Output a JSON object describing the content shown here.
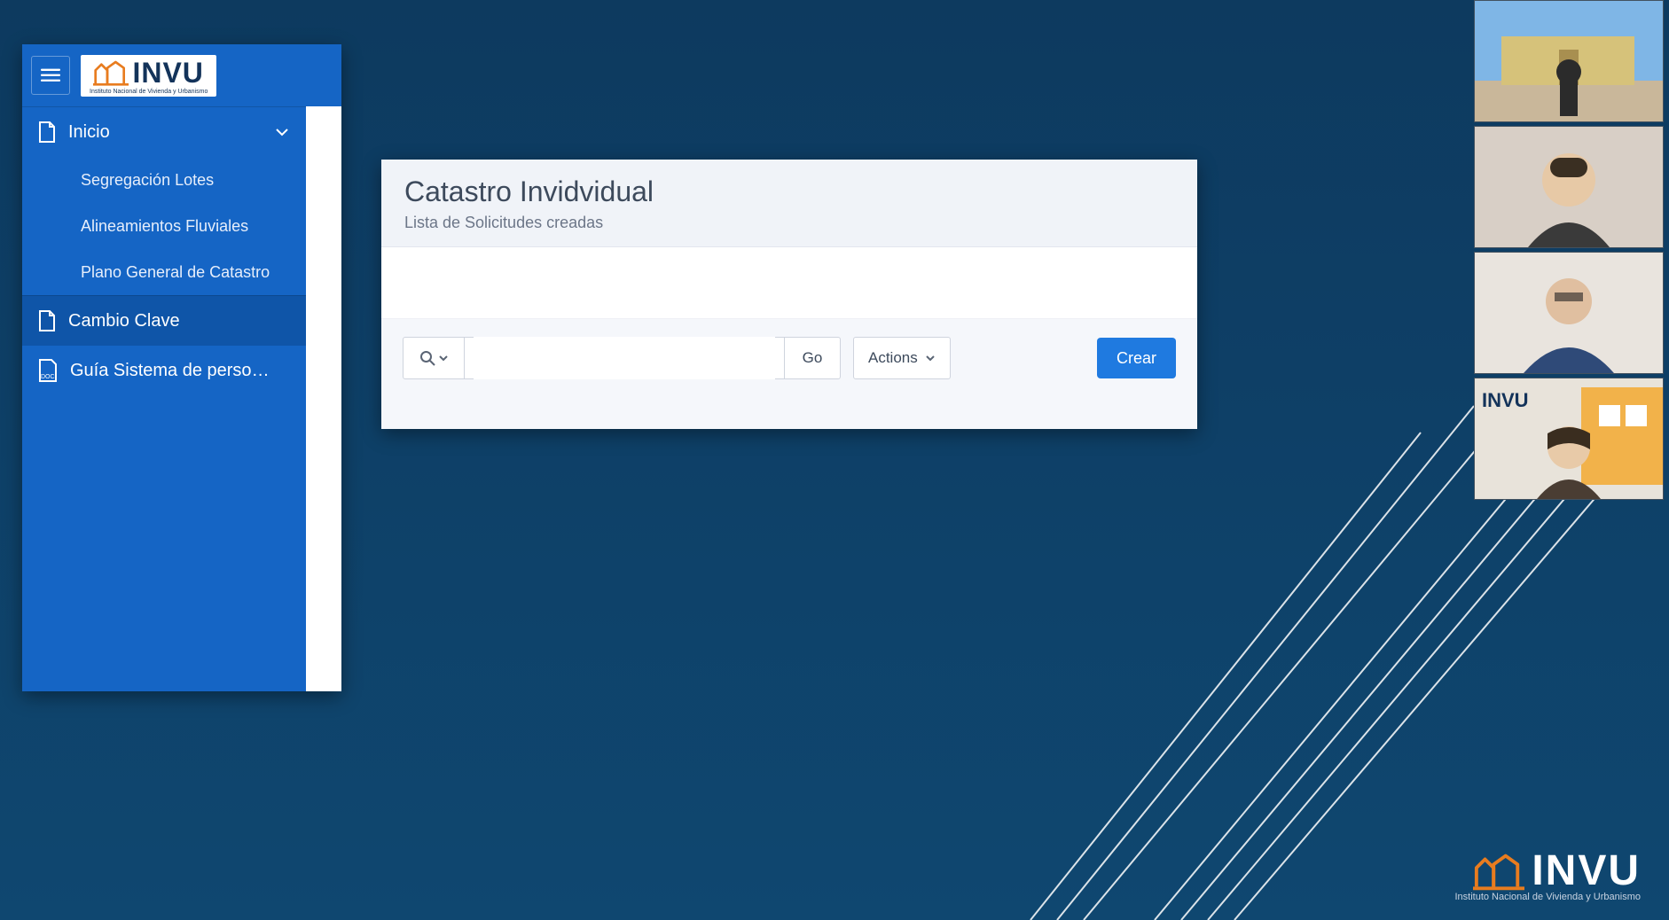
{
  "brand": {
    "name": "INVU",
    "tagline": "Instituto Nacional de Vivienda y Urbanismo"
  },
  "sidebar": {
    "items": [
      {
        "label": "Inicio",
        "expanded": true
      },
      {
        "label": "Cambio Clave"
      },
      {
        "label": "Guía Sistema de person…"
      }
    ],
    "subitems": [
      {
        "label": "Segregación Lotes"
      },
      {
        "label": "Alineamientos Fluviales"
      },
      {
        "label": "Plano General de Catastro"
      }
    ]
  },
  "content": {
    "title": "Catastro Invidvidual",
    "subtitle": "Lista de Solicitudes creadas",
    "go_label": "Go",
    "actions_label": "Actions",
    "create_label": "Crear",
    "search_value": ""
  },
  "footer_brand": {
    "name": "INVU",
    "tagline": "Instituto Nacional de Vivienda y Urbanismo"
  }
}
